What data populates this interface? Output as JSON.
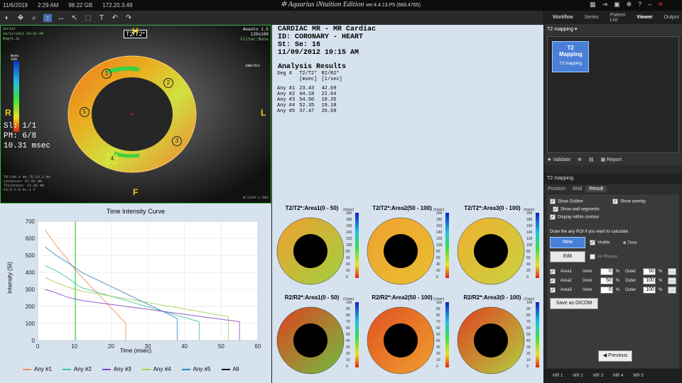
{
  "topbar": {
    "date": "11/6/2019",
    "time": "2:29 AM",
    "storage": "98.22 GB",
    "ip": "172.20.3.49"
  },
  "brand": {
    "name": "Aquarius",
    "edition": "iNtuition Edition",
    "version": "ver.4.4.13.P5 (668.4765)"
  },
  "right_tabs": [
    "Workflow",
    "Series",
    "Patient List",
    "Viewer",
    "Output"
  ],
  "mr": {
    "tl": [
      "Serial",
      "10/12/2012 10:32 AM",
      "Mag=1.31"
    ],
    "tr": [
      "Avanto 1.5",
      "120x160",
      "Filter:None"
    ],
    "scale_unit": "msec",
    "scale_max": "200",
    "scale_min": "0",
    "orient": {
      "top": "H",
      "left": "R",
      "right": "L",
      "bottom": "F"
    },
    "tag": "T2/T2*",
    "scale_note": "1mm/div",
    "info": [
      "Sl: 1/1",
      "Ph: 6/8",
      "10.31 msec"
    ],
    "bl": [
      "TR:240.0 ms TE:10.3 ms",
      "Location: 87.06 mm",
      "Thickness: 10.00 mm",
      "FA:8 F:8 EL:1 P"
    ],
    "br": [
      "W:1194 L:582"
    ],
    "segments": [
      "1",
      "2",
      "3",
      "4",
      "5"
    ]
  },
  "report": {
    "lines": [
      "CARDIAC MR - MR Cardiac",
      "ID: CORONARY - HEART",
      "St:    Se: 16",
      "11/09/2012     10:15 AM"
    ],
    "heading": "Analysis Results",
    "cols": [
      "Seg #",
      "T2/T2*",
      "R2/R2*"
    ],
    "units": [
      "",
      "[msec]",
      "[1/sec]"
    ],
    "rows": [
      [
        "Any #1",
        "23.43",
        "42.69"
      ],
      [
        "Any #2",
        "44.18",
        "22.64"
      ],
      [
        "Any #3",
        "54.50",
        "18.35"
      ],
      [
        "Any #4",
        "52.35",
        "19.10"
      ],
      [
        "Any #5",
        "37.47",
        "26.69"
      ]
    ]
  },
  "chart_data": {
    "type": "line",
    "title": "Time Intensity Curve",
    "xlabel": "Time (msec)",
    "ylabel": "Intensity (SI)",
    "xlim": [
      0,
      60
    ],
    "ylim": [
      0,
      700
    ],
    "xticks": [
      0,
      10,
      20,
      30,
      40,
      50,
      60
    ],
    "yticks": [
      0,
      100,
      200,
      300,
      400,
      500,
      600,
      700
    ],
    "marker_x": 10.3,
    "series": [
      {
        "name": "Any #1",
        "color": "#f08a5a",
        "x": [
          2,
          5,
          8,
          10,
          24
        ],
        "y": [
          650,
          560,
          480,
          420,
          100
        ],
        "end": 24
      },
      {
        "name": "Any #2",
        "color": "#40c0a0",
        "x": [
          2,
          5,
          8,
          12,
          44
        ],
        "y": [
          440,
          410,
          370,
          310,
          110
        ],
        "end": 44
      },
      {
        "name": "Any #3",
        "color": "#8040c0",
        "x": [
          2,
          5,
          8,
          12,
          55
        ],
        "y": [
          300,
          280,
          255,
          235,
          110
        ],
        "end": 55
      },
      {
        "name": "Any #4",
        "color": "#a0d050",
        "x": [
          2,
          5,
          8,
          12,
          52
        ],
        "y": [
          370,
          340,
          315,
          290,
          140
        ],
        "end": 52
      },
      {
        "name": "Any #5",
        "color": "#3080c0",
        "x": [
          2,
          5,
          8,
          12,
          38
        ],
        "y": [
          550,
          500,
          460,
          400,
          130
        ],
        "end": 38
      },
      {
        "name": "All",
        "color": "#111111",
        "x": [],
        "y": []
      }
    ]
  },
  "bulls": [
    {
      "title": "T2/T2*:Area1(0 - 50)",
      "unit": "(msec)",
      "ticks": [
        "200",
        "180",
        "160",
        "140",
        "120",
        "100",
        "80",
        "60",
        "40",
        "20",
        "0"
      ],
      "c1": "#f0a030",
      "c2": "#a0d040"
    },
    {
      "title": "T2/T2*:Area2(50 - 100)",
      "unit": "(msec)",
      "ticks": [
        "200",
        "180",
        "160",
        "140",
        "120",
        "100",
        "80",
        "60",
        "40",
        "20",
        "0"
      ],
      "c1": "#f0a030",
      "c2": "#e8c030"
    },
    {
      "title": "T2/T2*:Area3(0 - 100)",
      "unit": "(msec)",
      "ticks": [
        "200",
        "180",
        "160",
        "140",
        "120",
        "100",
        "80",
        "60",
        "40",
        "20",
        "0"
      ],
      "c1": "#f0b030",
      "c2": "#c8d040"
    },
    {
      "title": "R2/R2*:Area1(0 - 50)",
      "unit": "(1/sec)",
      "ticks": [
        "100",
        "90",
        "80",
        "70",
        "60",
        "50",
        "40",
        "30",
        "20",
        "10",
        "0"
      ],
      "c1": "#e04020",
      "c2": "#70c040"
    },
    {
      "title": "R2/R2*:Area2(50 - 100)",
      "unit": "(1/sec)",
      "ticks": [
        "100",
        "90",
        "80",
        "70",
        "60",
        "50",
        "40",
        "30",
        "20",
        "10",
        "0"
      ],
      "c1": "#e05020",
      "c2": "#f0a030"
    },
    {
      "title": "R2/R2*:Area3(0 - 100)",
      "unit": "(1/sec)",
      "ticks": [
        "100",
        "90",
        "80",
        "70",
        "60",
        "50",
        "40",
        "30",
        "20",
        "10",
        "0"
      ],
      "c1": "#e04020",
      "c2": "#b0d040"
    }
  ],
  "panel": {
    "protocol": "T2 mapping",
    "thumb_title": "T2 Mapping",
    "thumb_label": "T2 mapping",
    "validate": "Validate",
    "report": "Report",
    "section": "T2 mapping",
    "subtabs": [
      "Position",
      "Wall",
      "Result"
    ],
    "opts": [
      "Show Outline",
      "Show overlay",
      "Show wall segments",
      "Display within contour"
    ],
    "draw_text": "Draw the any ROI if you want to calculate.",
    "new": "New",
    "edit": "Edit",
    "visible": "Visible",
    "size": "7mm",
    "all_phases": "All Phases",
    "areas": [
      {
        "name": "Area1",
        "inner": "0",
        "outer": "50"
      },
      {
        "name": "Area2",
        "inner": "50",
        "outer": "100"
      },
      {
        "name": "Area3",
        "inner": "0",
        "outer": "100"
      }
    ],
    "inner_lbl": "Inner",
    "outer_lbl": "Outer",
    "pct": "%",
    "save": "Save as DICOM",
    "previous": "Previous",
    "bottom_tabs": [
      "MR 1",
      "MR 2",
      "MR 3",
      "MR 4",
      "MR 5"
    ]
  }
}
